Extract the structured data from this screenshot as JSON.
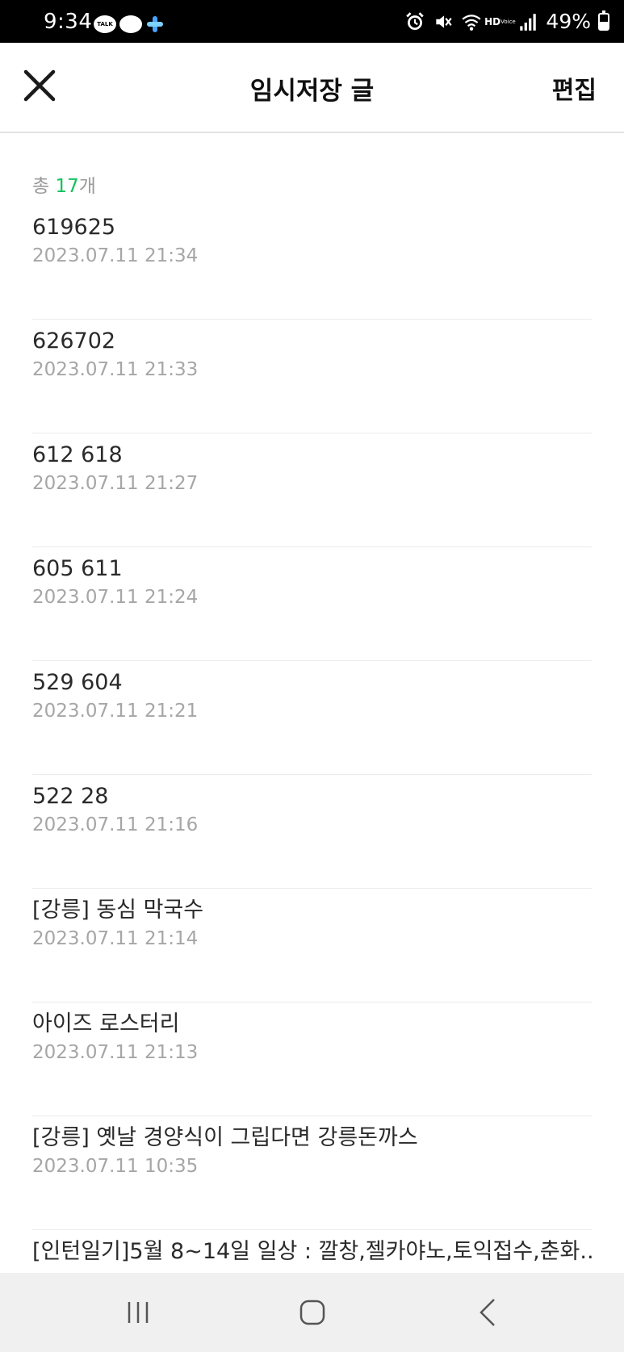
{
  "status_bar": {
    "time": "9:34",
    "talk_label": "TALK",
    "hd_label": "HD",
    "voice_label": "Voice",
    "battery": "49%",
    "icons": [
      "kakaotalk-icon",
      "chat-bubble-icon",
      "plus-app-icon",
      "alarm-icon",
      "mute-icon",
      "wifi-icon",
      "hd-voice-icon",
      "signal-icon",
      "battery-icon"
    ]
  },
  "header": {
    "title": "임시저장 글",
    "edit_label": "편집",
    "close_icon": "close-icon"
  },
  "summary": {
    "prefix": "총 ",
    "count": "17",
    "suffix": "개",
    "accent_color": "#13c25c"
  },
  "posts": [
    {
      "title": "619625",
      "date": "2023.07.11 21:34"
    },
    {
      "title": "626702",
      "date": "2023.07.11 21:33"
    },
    {
      "title": "612 618",
      "date": "2023.07.11 21:27"
    },
    {
      "title": "605 611",
      "date": "2023.07.11 21:24"
    },
    {
      "title": "529 604",
      "date": "2023.07.11 21:21"
    },
    {
      "title": "522 28",
      "date": "2023.07.11 21:16"
    },
    {
      "title": "[강릉] 동심 막국수",
      "date": "2023.07.11 21:14"
    },
    {
      "title": "아이즈 로스터리",
      "date": "2023.07.11 21:13"
    },
    {
      "title": "[강릉] 옛날 경양식이 그립다면 강릉돈까스",
      "date": "2023.07.11 10:35"
    },
    {
      "title": "[인턴일기]5월 8~14일 일상 : 깔창,젤카야노,토익접수,춘화...",
      "date": ""
    }
  ],
  "nav": {
    "icons": [
      "recent-apps-icon",
      "home-icon",
      "back-icon"
    ]
  }
}
